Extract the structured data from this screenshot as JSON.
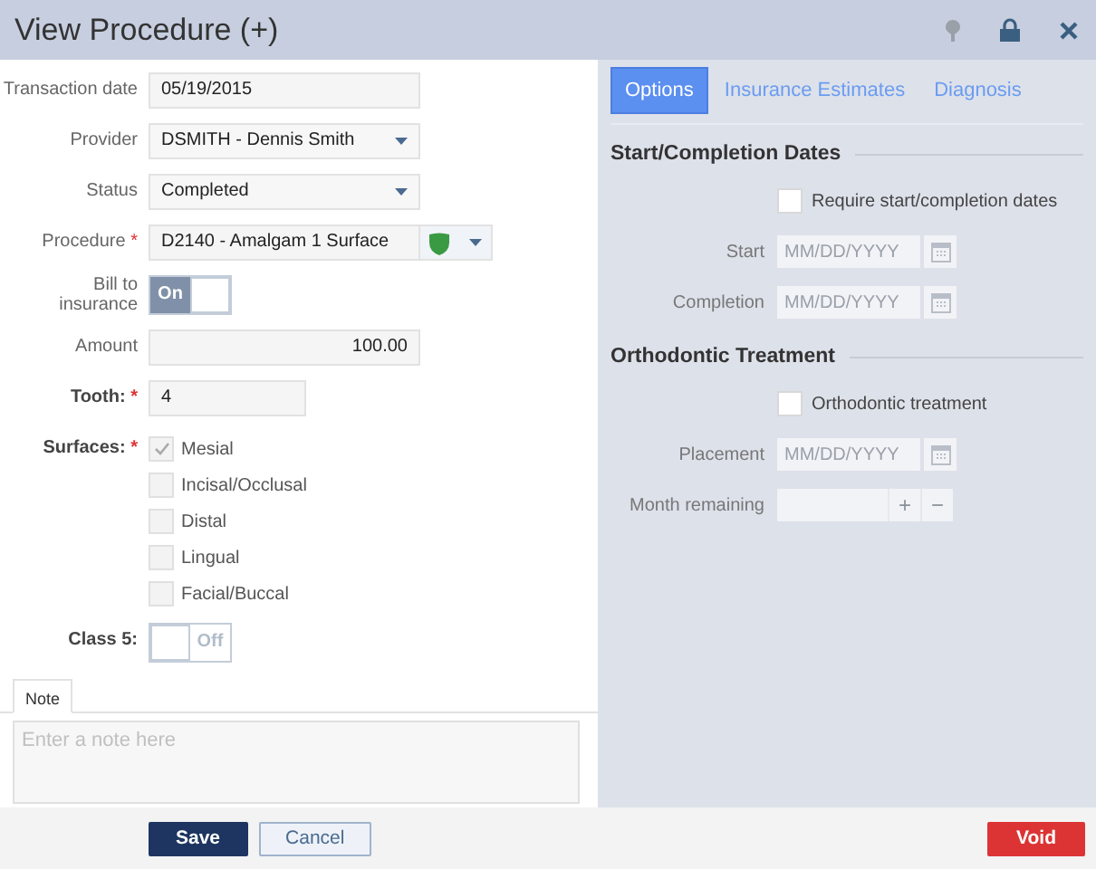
{
  "window": {
    "title": "View Procedure (+)"
  },
  "form": {
    "fields": [
      {
        "kind": "text",
        "label": "Transaction date",
        "bold": false,
        "value": "05/19/2015"
      },
      {
        "kind": "select",
        "label": "Provider",
        "bold": false,
        "value": "DSMITH - Dennis Smith"
      },
      {
        "kind": "select",
        "label": "Status",
        "bold": false,
        "value": "Completed"
      },
      {
        "kind": "procedure",
        "label": "Procedure",
        "marker": "*",
        "bold": false,
        "value": "D2140 - Amalgam 1 Surface"
      },
      {
        "kind": "toggle",
        "label": "Bill to insurance",
        "bold": false,
        "on": true,
        "text": "On"
      },
      {
        "kind": "amount",
        "label": "Amount",
        "bold": false,
        "value": "100.00"
      },
      {
        "kind": "tooth",
        "label": "Tooth:",
        "marker": "*",
        "bold": true,
        "value": "4"
      },
      {
        "kind": "checks",
        "label": "Surfaces:",
        "marker": "*",
        "bold": true,
        "items": [
          {
            "label": "Mesial",
            "checked": true
          },
          {
            "label": "Incisal/Occlusal",
            "checked": false
          },
          {
            "label": "Distal",
            "checked": false
          },
          {
            "label": "Lingual",
            "checked": false
          },
          {
            "label": "Facial/Buccal",
            "checked": false
          }
        ]
      },
      {
        "kind": "toggle",
        "label": "Class 5:",
        "bold": true,
        "on": false,
        "text": "Off"
      }
    ]
  },
  "note": {
    "tabs": [
      {
        "label": "Note",
        "selected": true
      }
    ],
    "placeholder": "Enter a note here"
  },
  "side": {
    "tabs": [
      {
        "label": "Options",
        "selected": true
      },
      {
        "label": "Insurance Estimates",
        "selected": false
      },
      {
        "label": "Diagnosis",
        "selected": false
      }
    ],
    "sections": [
      {
        "title": "Start/Completion Dates",
        "rows": [
          {
            "kind": "checkbox",
            "label": "Require start/completion dates",
            "checked": false
          },
          {
            "kind": "date",
            "label": "Start",
            "placeholder": "MM/DD/YYYY"
          },
          {
            "kind": "date",
            "label": "Completion",
            "placeholder": "MM/DD/YYYY"
          }
        ]
      },
      {
        "title": "Orthodontic Treatment",
        "rows": [
          {
            "kind": "checkbox",
            "label": "Orthodontic treatment",
            "checked": false
          },
          {
            "kind": "date",
            "label": "Placement",
            "placeholder": "MM/DD/YYYY"
          },
          {
            "kind": "stepper",
            "label": "Month remaining",
            "plus": "+",
            "minus": "−"
          }
        ]
      }
    ]
  },
  "buttons": [
    {
      "kind": "primary",
      "label": "Save"
    },
    {
      "kind": "secondary",
      "label": "Cancel"
    },
    {
      "kind": "danger",
      "label": "Void"
    }
  ]
}
